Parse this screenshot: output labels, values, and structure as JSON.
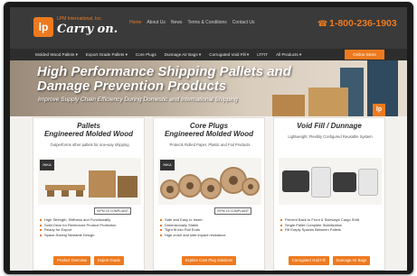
{
  "header": {
    "logo_text": "lp",
    "brand_small": "LPM International, Inc.",
    "brand_tagline": "Carry on.",
    "nav": [
      "Home",
      "About Us",
      "News",
      "Terms & Conditions",
      "Contact Us"
    ],
    "active_nav": "Home",
    "phone": "1-800-236-1903"
  },
  "subnav": {
    "items": [
      "Molded Wood Pallets ▾",
      "Export Grade Pallets ▾",
      "Core Plugs",
      "Dunnage Air Bags ▾",
      "Corrugated Void Fill ▾",
      "LTFIT",
      "All Products ▾"
    ],
    "quote_label": "Online Store"
  },
  "hero": {
    "title": "High Performance Shipping Pallets and Damage Prevention Products",
    "subtitle": "Improve Supply Chain Efficiency During Domestic and International Shipping",
    "badge": "lp"
  },
  "cards": [
    {
      "title_line1": "Pallets",
      "title_line2": "Engineered Molded Wood",
      "description": "Outperforms other pallets for one-way shipping",
      "made_badge": "INKA",
      "compliance": "ISPM 15 COMPLIANT",
      "features": [
        "High Strength, Stiffness and Functionality",
        "Solid Deck for Reinforced Product Protection",
        "Ready for Export",
        "Space-Saving Nestable Design"
      ],
      "buttons": [
        "Product Overview",
        "Export Grade"
      ]
    },
    {
      "title_line1": "Core Plugs",
      "title_line2": "Engineered Molded Wood",
      "description": "Protects Rolled Paper, Plastic and Foil Products",
      "made_badge": "INKA",
      "compliance": "ISPM 15 COMPLIANT",
      "features": [
        "Safe and Easy to Insert",
        "Dimensionally Stable",
        "Tight fit Into Roll Ends",
        "High crush and side impact resistance"
      ],
      "buttons": [
        "Explore Core Plug Solutions"
      ]
    },
    {
      "title_line1": "Void Fill / Dunnage",
      "title_line2": "",
      "description": "Lightweight, Flexibly Configured Reusable System",
      "made_badge": "",
      "compliance": "",
      "features": [
        "Prevent Back to Front & Sideways Cargo Shift",
        "Single Pallet Complete Stabilization",
        "Fill Empty Spaces Between Pallets"
      ],
      "buttons": [
        "Corrugated Void Fill",
        "Dunnage Air Bags"
      ]
    }
  ],
  "colors": {
    "accent": "#ee7a1f",
    "header_bg": "#3a3a3a",
    "subnav_bg": "#2d2d2d"
  },
  "icons": {
    "phone": "phone-icon"
  }
}
